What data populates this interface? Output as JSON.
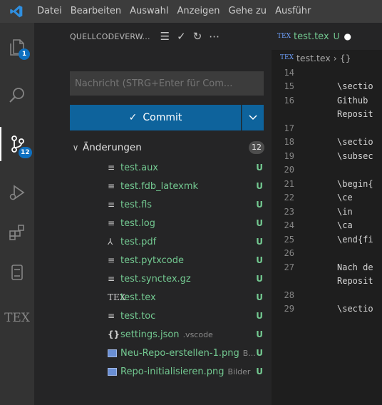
{
  "menu": [
    "Datei",
    "Bearbeiten",
    "Auswahl",
    "Anzeigen",
    "Gehe zu",
    "Ausführ"
  ],
  "activity": {
    "explorer_badge": "1",
    "scm_badge": "12",
    "tex_label": "TEX"
  },
  "scm": {
    "title": "QUELLCODEVERW...",
    "message_placeholder": "Nachricht (STRG+Enter für Com...",
    "commit_label": "Commit",
    "changes_label": "Änderungen",
    "changes_count": "12",
    "files": [
      {
        "name": "test.aux",
        "dir": "",
        "status": "U",
        "icon": "file-lines-icon"
      },
      {
        "name": "test.fdb_latexmk",
        "dir": "",
        "status": "U",
        "icon": "file-lines-icon"
      },
      {
        "name": "test.fls",
        "dir": "",
        "status": "U",
        "icon": "file-lines-icon"
      },
      {
        "name": "test.log",
        "dir": "",
        "status": "U",
        "icon": "file-lines-icon"
      },
      {
        "name": "test.pdf",
        "dir": "",
        "status": "U",
        "icon": "pdf-icon"
      },
      {
        "name": "test.pytxcode",
        "dir": "",
        "status": "U",
        "icon": "file-lines-icon"
      },
      {
        "name": "test.synctex.gz",
        "dir": "",
        "status": "U",
        "icon": "file-lines-icon"
      },
      {
        "name": "test.tex",
        "dir": "",
        "status": "U",
        "icon": "tex-icon"
      },
      {
        "name": "test.toc",
        "dir": "",
        "status": "U",
        "icon": "file-lines-icon"
      },
      {
        "name": "settings.json",
        "dir": ".vscode",
        "status": "U",
        "icon": "json-icon"
      },
      {
        "name": "Neu-Repo-erstellen-1.png",
        "dir": "B...",
        "status": "U",
        "icon": "image-icon"
      },
      {
        "name": "Repo-initialisieren.png",
        "dir": "Bilder",
        "status": "U",
        "icon": "image-icon"
      }
    ]
  },
  "editor": {
    "tab_name": "test.tex",
    "tab_status": "U",
    "breadcrumb_file": "test.tex",
    "breadcrumb_symbol": "{}",
    "lines": [
      {
        "n": "14",
        "t": ""
      },
      {
        "n": "15",
        "t": "\\sectio"
      },
      {
        "n": "16",
        "t": "Github"
      },
      {
        "n": "",
        "t": "Reposit"
      },
      {
        "n": "17",
        "t": ""
      },
      {
        "n": "18",
        "t": "\\sectio"
      },
      {
        "n": "19",
        "t": "\\subsec"
      },
      {
        "n": "20",
        "t": ""
      },
      {
        "n": "21",
        "t": "\\begin{"
      },
      {
        "n": "22",
        "t": "    \\ce"
      },
      {
        "n": "23",
        "t": "    \\in"
      },
      {
        "n": "24",
        "t": "    \\ca"
      },
      {
        "n": "25",
        "t": "\\end{fi"
      },
      {
        "n": "26",
        "t": ""
      },
      {
        "n": "27",
        "t": "Nach de"
      },
      {
        "n": "",
        "t": "Reposit"
      },
      {
        "n": "28",
        "t": ""
      },
      {
        "n": "29",
        "t": "\\sectio"
      }
    ]
  }
}
